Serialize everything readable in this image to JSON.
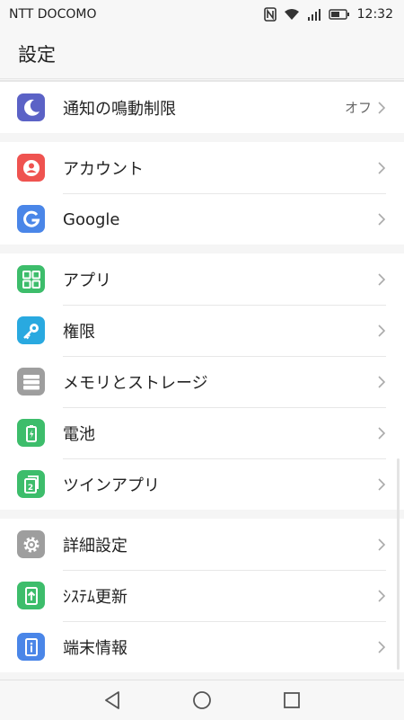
{
  "status_bar": {
    "carrier": "NTT DOCOMO",
    "time": "12:32",
    "icons": [
      "nfc-icon",
      "wifi-icon",
      "signal-icon",
      "battery-icon"
    ]
  },
  "header": {
    "title": "設定"
  },
  "groups": [
    [
      {
        "label": "通知の鳴動制限",
        "value": "オフ",
        "icon": "moon-icon",
        "color": "#5b62c6"
      }
    ],
    [
      {
        "label": "アカウント",
        "icon": "account-icon",
        "color": "#ef5350"
      },
      {
        "label": "Google",
        "icon": "google-icon",
        "color": "#4a86e8"
      }
    ],
    [
      {
        "label": "アプリ",
        "icon": "apps-icon",
        "color": "#3dbd6b"
      },
      {
        "label": "権限",
        "icon": "key-icon",
        "color": "#29a9e0"
      },
      {
        "label": "メモリとストレージ",
        "icon": "storage-icon",
        "color": "#9e9e9e"
      },
      {
        "label": "電池",
        "icon": "battery-icon",
        "color": "#3dbd6b"
      },
      {
        "label": "ツインアプリ",
        "icon": "twin-app-icon",
        "color": "#3dbd6b"
      }
    ],
    [
      {
        "label": "詳細設定",
        "icon": "gear-icon",
        "color": "#9e9e9e"
      },
      {
        "label": "ｼｽﾃﾑ更新",
        "icon": "system-update-icon",
        "color": "#3dbd6b"
      },
      {
        "label": "端末情報",
        "icon": "info-icon",
        "color": "#4a86e8"
      }
    ]
  ],
  "navbar": {
    "buttons": [
      "back-icon",
      "home-icon",
      "recents-icon"
    ]
  }
}
